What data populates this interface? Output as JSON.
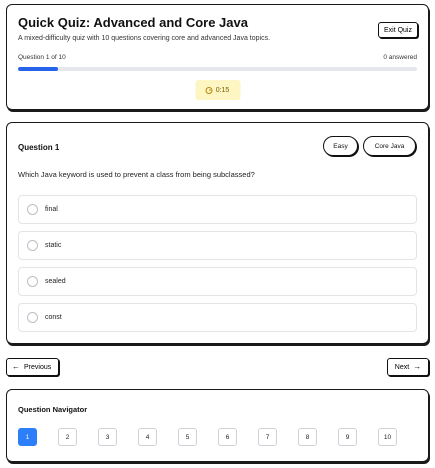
{
  "header": {
    "title": "Quick Quiz: Advanced and Core Java",
    "description": "A mixed-difficulty quiz with 10 questions covering core and advanced Java topics.",
    "exit_label": "Exit Quiz",
    "question_counter": "Question 1 of 10",
    "answered": "0 answered",
    "progress_fraction": 0.1,
    "timer": "0:15"
  },
  "question": {
    "heading": "Question 1",
    "difficulty": "Easy",
    "topic": "Core Java",
    "text": "Which Java keyword is used to prevent a class from being subclassed?",
    "options": [
      {
        "label": "final"
      },
      {
        "label": "static"
      },
      {
        "label": "sealed"
      },
      {
        "label": "const"
      }
    ]
  },
  "nav": {
    "prev_label": "Previous",
    "next_label": "Next"
  },
  "navigator": {
    "title": "Question Navigator",
    "numbers": [
      "1",
      "2",
      "3",
      "4",
      "5",
      "6",
      "7",
      "8",
      "9",
      "10"
    ],
    "active": "1"
  },
  "colors": {
    "accent": "#2563eb",
    "timer_bg": "#fdf6c3"
  }
}
